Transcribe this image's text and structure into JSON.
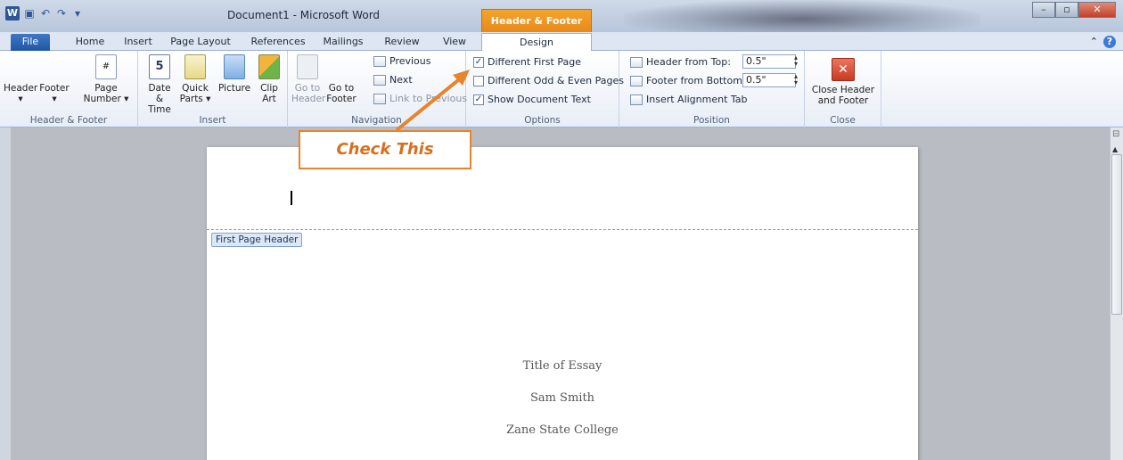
{
  "window": {
    "title": "Document1 - Microsoft Word",
    "contextual_tab": "Header & Footer Tools",
    "app_icon": "W"
  },
  "tabs": [
    "File",
    "Home",
    "Insert",
    "Page Layout",
    "References",
    "Mailings",
    "Review",
    "View",
    "Design"
  ],
  "groups": {
    "header_footer": {
      "label": "Header & Footer",
      "header": "Header",
      "footer": "Footer",
      "page_number_1": "Page",
      "page_number_2": "Number",
      "page_number_icon": "#"
    },
    "insert": {
      "label": "Insert",
      "date_1": "Date",
      "date_2": "& Time",
      "date_icon": "5",
      "quick_1": "Quick",
      "quick_2": "Parts",
      "picture": "Picture",
      "clip_1": "Clip",
      "clip_2": "Art"
    },
    "navigation": {
      "label": "Navigation",
      "goto_header_1": "Go to",
      "goto_header_2": "Header",
      "goto_footer_1": "Go to",
      "goto_footer_2": "Footer",
      "previous": "Previous",
      "next": "Next",
      "link_previous": "Link to Previous"
    },
    "options": {
      "label": "Options",
      "different_first_page": "Different First Page",
      "different_first_page_checked": true,
      "different_odd_even": "Different Odd & Even Pages",
      "different_odd_even_checked": false,
      "show_document_text": "Show Document Text",
      "show_document_text_checked": true,
      "check_mark": "✓"
    },
    "position": {
      "label": "Position",
      "header_from_top": "Header from Top:",
      "header_from_top_value": "0.5\"",
      "footer_from_bottom": "Footer from Bottom:",
      "footer_from_bottom_value": "0.5\"",
      "insert_alignment_tab": "Insert Alignment Tab"
    },
    "close": {
      "label": "Close",
      "close_1": "Close Header",
      "close_2": "and Footer",
      "close_icon": "✕"
    }
  },
  "document": {
    "header_tag": "First Page Header",
    "lines": [
      "Title of Essay",
      "Sam Smith",
      "Zane State College"
    ]
  },
  "callout": {
    "text": "Check This",
    "color": "#e8842c"
  }
}
